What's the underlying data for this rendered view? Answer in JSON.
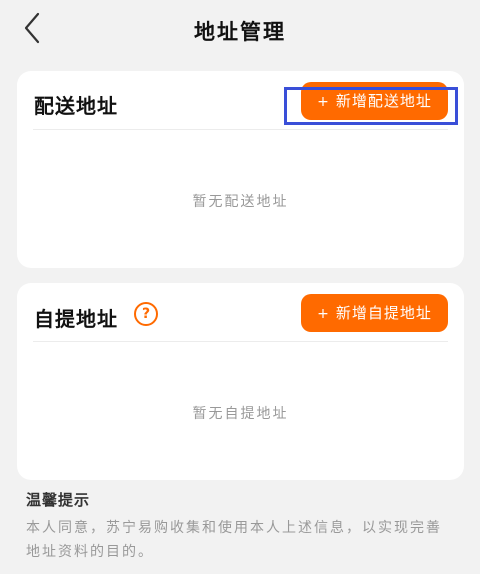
{
  "header": {
    "title": "地址管理",
    "back_icon": "chevron-left-icon"
  },
  "delivery": {
    "title": "配送地址",
    "add_plus": "+",
    "add_label": "新增配送地址",
    "empty_text": "暂无配送地址"
  },
  "pickup": {
    "title": "自提地址",
    "help_glyph": "?",
    "add_plus": "+",
    "add_label": "新增自提地址",
    "empty_text": "暂无自提地址"
  },
  "tips": {
    "title": "温馨提示",
    "body": "本人同意，苏宁易购收集和使用本人上述信息，以实现完善地址资料的目的。"
  },
  "colors": {
    "accent": "#ff6a00",
    "highlight": "#3a4fd8"
  }
}
